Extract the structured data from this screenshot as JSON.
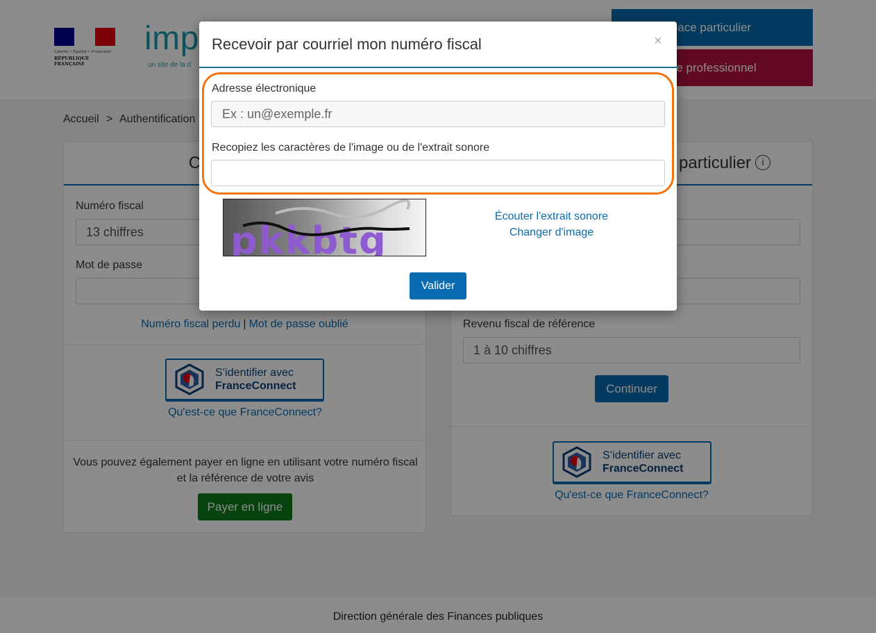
{
  "header": {
    "motto": "Liberté • Égalité • Fraternité",
    "republic": "RÉPUBLIQUE FRANÇAISE",
    "site_logo": "imp",
    "site_sub": "un site de la d",
    "btn_particulier": "re espace particulier",
    "btn_pro": "espace professionnel",
    "flag_colors": [
      "#000091",
      "#ffffff",
      "#e1000f"
    ]
  },
  "breadcrumb": {
    "home": "Accueil",
    "separator": ">",
    "current": "Authentification"
  },
  "left_card": {
    "title": "Connexion à m",
    "fiscal_label": "Numéro fiscal",
    "fiscal_placeholder": "13 chiffres",
    "password_label": "Mot de passe",
    "lost_fiscal": "Numéro fiscal perdu",
    "separator": "|",
    "forgot_password": "Mot de passe oublié",
    "fc_line1": "S’identifier avec",
    "fc_line2": "FranceConnect",
    "fc_link": "Qu'est-ce que FranceConnect?",
    "pay_text": "Vous pouvez également payer en ligne en utilisant votre numéro fiscal et la référence de votre avis",
    "pay_button": "Payer en ligne"
  },
  "right_card": {
    "title": "particulier",
    "revenue_label": "Revenu fiscal de référence",
    "revenue_placeholder": "1 à 10 chiffres",
    "continue_button": "Continuer",
    "fc_line1": "S’identifier avec",
    "fc_line2": "FranceConnect",
    "fc_link": "Qu'est-ce que FranceConnect?"
  },
  "footer": {
    "text": "Direction générale des Finances publiques"
  },
  "modal": {
    "title": "Recevoir par courriel mon numéro fiscal",
    "close": "×",
    "email_label": "Adresse électronique",
    "email_placeholder": "Ex : un@exemple.fr",
    "captcha_label": "Recopiez les caractères de l'image ou de l'extrait sonore",
    "captcha_value": "",
    "captcha_text": "pkkbtg",
    "listen_link": "Écouter l'extrait sonore",
    "change_link": "Changer d'image",
    "submit": "Valider",
    "highlight_color": "#f07411"
  }
}
